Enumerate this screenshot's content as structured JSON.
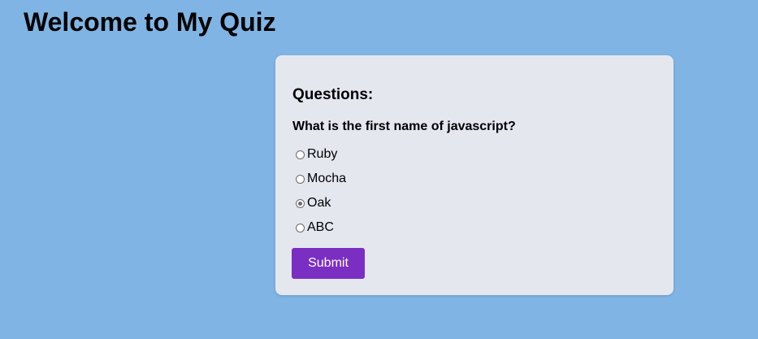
{
  "page": {
    "title": "Welcome to My Quiz"
  },
  "quiz": {
    "heading": "Questions:",
    "question": "What is the first name of javascript?",
    "options": [
      {
        "label": "Ruby",
        "selected": false
      },
      {
        "label": "Mocha",
        "selected": false
      },
      {
        "label": "Oak",
        "selected": true
      },
      {
        "label": "ABC",
        "selected": false
      }
    ],
    "submit_label": "Submit"
  },
  "colors": {
    "background": "#7fb4e4",
    "card": "#e5e7ef",
    "accent": "#7b2fc2"
  }
}
